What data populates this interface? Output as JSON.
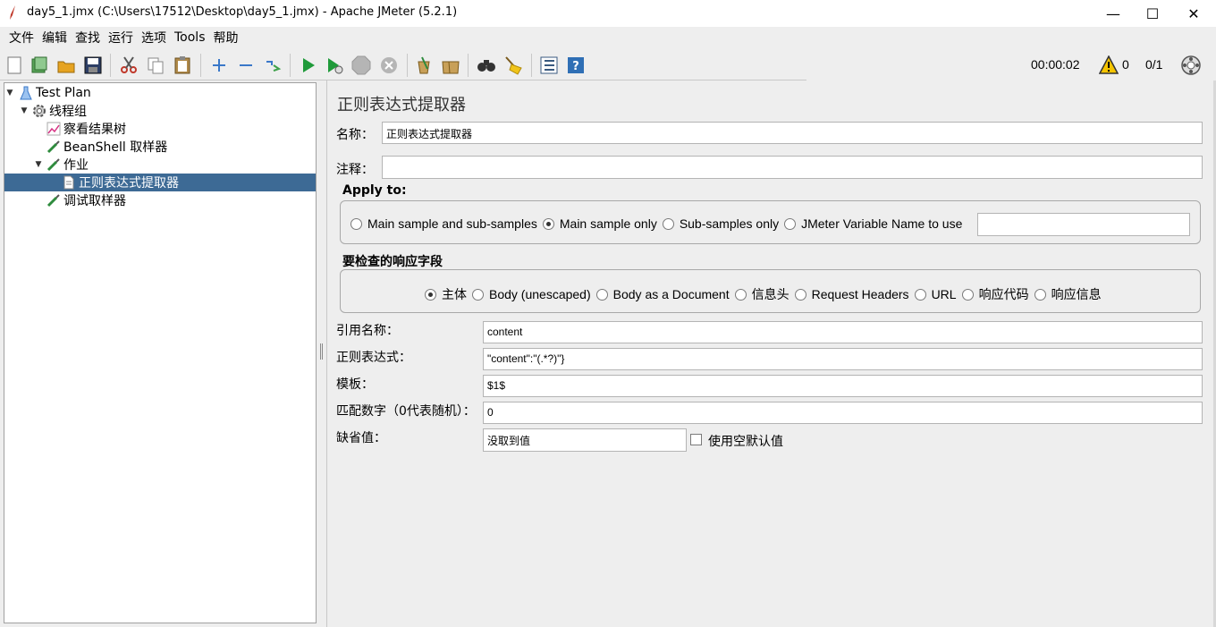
{
  "window": {
    "title": "day5_1.jmx (C:\\Users\\17512\\Desktop\\day5_1.jmx) - Apache JMeter (5.2.1)",
    "minimize": "—",
    "maximize": "☐",
    "close": "✕"
  },
  "menu": [
    "文件",
    "编辑",
    "查找",
    "运行",
    "选项",
    "Tools",
    "帮助"
  ],
  "status": {
    "elapsed": "00:00:02",
    "warnings": "0",
    "threads": "0/1"
  },
  "tree": [
    {
      "label": "Test Plan",
      "icon": "flask-icon",
      "expanded": true
    },
    {
      "label": "线程组",
      "icon": "gear-icon",
      "expanded": true
    },
    {
      "label": "察看结果树",
      "icon": "chart-icon"
    },
    {
      "label": "BeanShell 取样器",
      "icon": "pipette-icon"
    },
    {
      "label": "作业",
      "icon": "pipette-icon",
      "expanded": true
    },
    {
      "label": "正则表达式提取器",
      "icon": "document-icon",
      "selected": true
    },
    {
      "label": "调试取样器",
      "icon": "pipette-icon"
    }
  ],
  "panel": {
    "title": "正则表达式提取器",
    "name_label": "名称：",
    "name_value": "正则表达式提取器",
    "comment_label": "注释：",
    "comment_value": "",
    "apply_to": {
      "title": "Apply to:",
      "options": [
        "Main sample and sub-samples",
        "Main sample only",
        "Sub-samples only",
        "JMeter Variable Name to use"
      ],
      "selected": "Main sample only",
      "variable_value": ""
    },
    "field_to_check": {
      "title": "要检查的响应字段",
      "options": [
        "主体",
        "Body (unescaped)",
        "Body as a Document",
        "信息头",
        "Request Headers",
        "URL",
        "响应代码",
        "响应信息"
      ],
      "selected": "主体"
    },
    "ref_name_label": "引用名称：",
    "ref_name_value": "content",
    "regex_label": "正则表达式：",
    "regex_value": "\"content\":\"(.*?)\"}",
    "template_label": "模板：",
    "template_value": "$1$",
    "match_no_label": "匹配数字（0代表随机）：",
    "match_no_value": "0",
    "default_label": "缺省值：",
    "default_value": "没取到值",
    "use_empty_default_label": "使用空默认值",
    "use_empty_default_checked": false
  }
}
